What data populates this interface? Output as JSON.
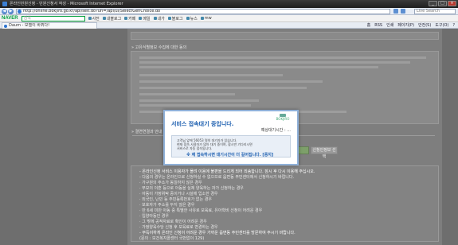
{
  "window": {
    "title": "온라인민원신청 - 민원신청서 작성 - Microsoft Internet Explorer",
    "buttons": {
      "minimize": "_",
      "maximize": "□",
      "close": "×"
    }
  },
  "address_bar": {
    "url": "http://online.bokjiro.go.kr/apl/selt.do?url=/apl/ui/SelectGenChoice.do",
    "search_placeholder": "Live Search"
  },
  "naver_toolbar": {
    "logo": "NAVER",
    "search_placeholder": "검색",
    "items": [
      "사전",
      "내블로그",
      "카페",
      "메일",
      "내가",
      "블로그",
      "뉴스",
      "mw"
    ]
  },
  "tab": {
    "label": "Daum - 모델이 바뀌다!"
  },
  "command_bar": {
    "items": [
      "홈",
      "RSS",
      "인쇄",
      "페이지(P)",
      "안전(S)",
      "도구(O)",
      "?"
    ]
  },
  "page": {
    "section1_title": "» 고유식별정보 수집에 대한 동의",
    "section2_title": "» 결연연결과 안내",
    "button_label": "신청인정보 선택"
  },
  "modal": {
    "title": "서비스 접속대기 중입니다.",
    "logo_text": "BOKJIRO",
    "wait_label": "예상대기시간 :",
    "wait_value": "...",
    "messages": [
      "고객님 앞에 56053 명의 대기자가 있습니다.",
      "현재 접속 사용자가 많아 대기 중이며, 잠시만 기다리시면",
      "서비스로 자동 접속됩니다."
    ],
    "warning": "※ 재 접속하시면 대기시간이 더 길어집니다. [중지]"
  },
  "notes": [
    "- 온라인신청 서비스 이용자가 몰려 이용에 불편을 드리게 되어 죄송합니다. 잠시 후 다시 이용해 주십시오.",
    "- 다음의 경우는 온라인으로 신청하실 수 없으므로 읍면동 주민센터에서 신청하시기 바랍니다.",
    "  · 가구원의 주소가 동일하지 않은 경우",
    "  · 부모의 이혼 등으로 아동을 실제 양육하는 자가 신청하는 경우",
    "  · 아동이 가정위탁 중이거나 시설에 입소한 경우",
    "  · 외국인, 난민 등 주민등록번호가 없는 경우",
    "  · 보호자가 주소를 두지 않은 경우",
    "  · 만 6세 미만 아동 중 특별한 사유로 보육료, 유아학비 신청이 어려운 경우",
    "  · 입양아동인 경우",
    "  · 그 밖에 공적자료로 확인이 어려운 경우",
    "  · 가정양육수당 신청 후 보육료로 변경하는 경우",
    "- 부득이하게 온라인 신청이 어려운 경우 가까운 읍면동 주민센터를 방문하여 주시기 바랍니다.",
    "  (문의 : 보건복지콜센터 국번없이 129)"
  ]
}
